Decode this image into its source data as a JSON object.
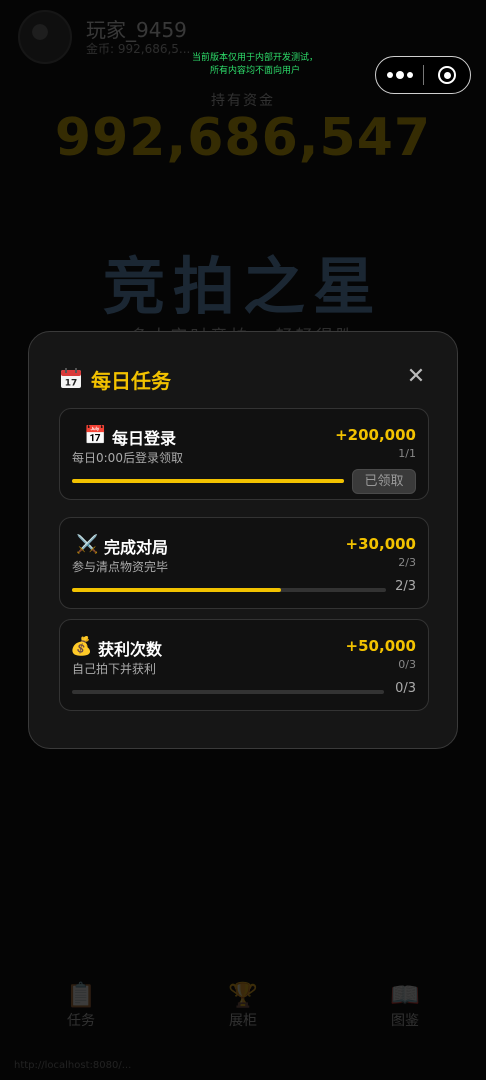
{
  "player": {
    "name": "玩家_9459",
    "coins_label": "金币: 992,686,5..."
  },
  "wealth": {
    "label": "持有资金",
    "value": "992,686,547"
  },
  "game": {
    "title": "竞拍之星",
    "subtitle": "多人实时竞拍 · 轻轻得胜"
  },
  "dev_notice": {
    "line1": "当前版本仅用于内部开发测试，",
    "line2": "所有内容均不面向用户"
  },
  "capsule": {
    "more_icon": "more-dots-icon",
    "close_icon": "target-close-icon"
  },
  "modal": {
    "title": "每日任务",
    "title_icon": "calendar-icon",
    "close_glyph": "✕",
    "accent": "#f2c200"
  },
  "tasks": [
    {
      "icon": "📅",
      "icon_name": "calendar-icon",
      "name": "每日登录",
      "desc": "每日0:00后登录领取",
      "reward": "+200,000",
      "count": "1/1",
      "progress": 1.0,
      "action": "已领取"
    },
    {
      "icon": "⚔️",
      "icon_name": "crossed-swords-icon",
      "name": "完成对局",
      "desc": "参与清点物资完毕",
      "reward": "+30,000",
      "count": "2/3",
      "progress": 0.6667,
      "progress_text": "2/3"
    },
    {
      "icon": "💰",
      "icon_name": "money-bag-icon",
      "name": "获利次数",
      "desc": "自己拍下并获利",
      "reward": "+50,000",
      "count": "0/3",
      "progress": 0.0,
      "progress_text": "0/3"
    }
  ],
  "nav": [
    {
      "label": "任务",
      "icon": "📋",
      "icon_name": "clipboard-icon"
    },
    {
      "label": "展柜",
      "icon": "🏆",
      "icon_name": "trophy-icon"
    },
    {
      "label": "图鉴",
      "icon": "📖",
      "icon_name": "book-icon"
    }
  ],
  "url_hint": "http://localhost:8080/..."
}
